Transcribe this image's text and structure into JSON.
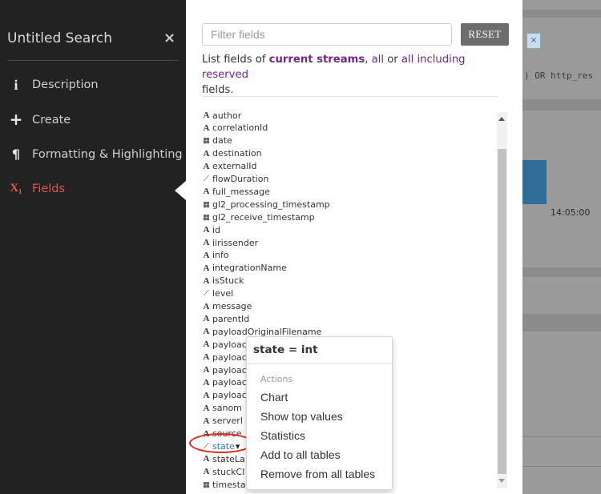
{
  "sidebar": {
    "title": "Untitled Search",
    "close_icon": "×",
    "items": [
      {
        "icon": "info-icon",
        "glyph": "i",
        "label": "Description"
      },
      {
        "icon": "plus-icon",
        "glyph": "+",
        "label": "Create"
      },
      {
        "icon": "pilcrow-icon",
        "glyph": "¶",
        "label": "Formatting & Highlighting"
      },
      {
        "icon": "fields-icon",
        "glyph": "X₁",
        "label": "Fields"
      }
    ],
    "active_color": "#e05a4a"
  },
  "fields_panel": {
    "filter_placeholder": "Filter fields",
    "reset_label": "RESET",
    "list_prefix": "List fields of ",
    "link_current": "current streams",
    "sep1": ", ",
    "link_all": "all",
    "sep2": " or ",
    "link_reserved": "all including reserved",
    "suffix": "fields.",
    "link_color": "#702785",
    "fields": [
      {
        "icon": "A",
        "name": "author"
      },
      {
        "icon": "A",
        "name": "correlationId"
      },
      {
        "icon": "date",
        "name": "date"
      },
      {
        "icon": "A",
        "name": "destination"
      },
      {
        "icon": "A",
        "name": "externalId"
      },
      {
        "icon": "num",
        "name": "flowDuration"
      },
      {
        "icon": "A",
        "name": "full_message"
      },
      {
        "icon": "date",
        "name": "gl2_processing_timestamp"
      },
      {
        "icon": "date",
        "name": "gl2_receive_timestamp"
      },
      {
        "icon": "A",
        "name": "id"
      },
      {
        "icon": "A",
        "name": "iirissender"
      },
      {
        "icon": "A",
        "name": "info"
      },
      {
        "icon": "A",
        "name": "integrationName"
      },
      {
        "icon": "A",
        "name": "isStuck"
      },
      {
        "icon": "num",
        "name": "level"
      },
      {
        "icon": "A",
        "name": "message"
      },
      {
        "icon": "A",
        "name": "parentId"
      },
      {
        "icon": "A",
        "name": "payloadOriginalFilename"
      },
      {
        "icon": "A",
        "name": "payloac"
      },
      {
        "icon": "A",
        "name": "payloac"
      },
      {
        "icon": "A",
        "name": "payloac                                       n"
      },
      {
        "icon": "A",
        "name": "payloac"
      },
      {
        "icon": "A",
        "name": "payloac"
      },
      {
        "icon": "A",
        "name": "sanom"
      },
      {
        "icon": "A",
        "name": "serverl"
      },
      {
        "icon": "A",
        "name": "source"
      },
      {
        "icon": "num",
        "name": "state",
        "dropdown": "▾"
      },
      {
        "icon": "A",
        "name": "stateLa"
      },
      {
        "icon": "A",
        "name": "stuckCl"
      },
      {
        "icon": "date",
        "name": "timesta"
      }
    ]
  },
  "popover": {
    "title": "state = int",
    "actions_header": "Actions",
    "actions": [
      "Chart",
      "Show top values",
      "Statistics",
      "Add to all tables",
      "Remove from all tables"
    ]
  },
  "background": {
    "chip": "×",
    "code": ") OR http_res",
    "time_label": "14:05:00",
    "bar_color": "#2f6d98"
  },
  "icons": {
    "A": "string-type-icon",
    "date": "date-type-icon",
    "num": "numeric-type-icon"
  },
  "highlight_color": "#e0261b"
}
